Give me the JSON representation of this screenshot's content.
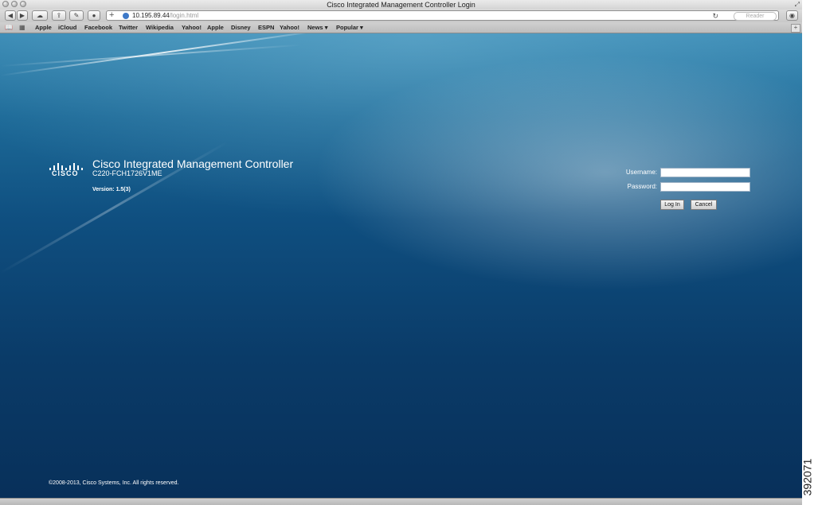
{
  "window": {
    "title": "Cisco Integrated Management Controller Login"
  },
  "toolbar": {
    "url_host": "10.195.89.44",
    "url_path": "/login.html",
    "reader_label": "Reader"
  },
  "bookmarks": [
    "Apple",
    "iCloud",
    "Facebook",
    "Twitter",
    "Wikipedia",
    "Yahoo!",
    "Apple",
    "Disney",
    "ESPN",
    "Yahoo!",
    "News",
    "Popular"
  ],
  "page": {
    "logo_text": "CISCO",
    "app_title": "Cisco Integrated Management Controller",
    "serial": "C220-FCH1726V1ME",
    "version": "Version: 1.5(3)",
    "copyright": "©2008-2013, Cisco Systems, Inc. All rights reserved."
  },
  "login": {
    "username_label": "Username:",
    "username_value": "",
    "password_label": "Password:",
    "password_value": "",
    "login_button": "Log In",
    "cancel_button": "Cancel"
  },
  "figure_id": "392071",
  "colors": {
    "background_top": "#3a8bb5",
    "background_bottom": "#08305a"
  }
}
